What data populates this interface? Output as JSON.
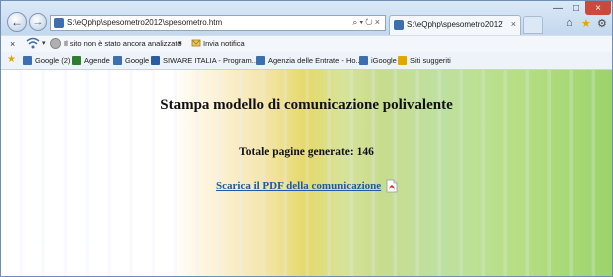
{
  "browser": {
    "address_url": "S:\\eQphp\\spesometro2012\\spesometro.htm",
    "tab_title": "S:\\eQphp\\spesometro2012\\...",
    "window_controls": [
      "minimize",
      "maximize",
      "close"
    ]
  },
  "toolbar": {
    "safety_status": "Il sito non è stato ancora analizzato",
    "send_report": "Invia notifica"
  },
  "favorites": [
    {
      "label": "Google (2)",
      "icon": "google-icon",
      "color": "#3c6eb0"
    },
    {
      "label": "Agende",
      "icon": "agenda-icon",
      "color": "#2f7d2f"
    },
    {
      "label": "Google",
      "icon": "google-icon",
      "color": "#3c6eb0"
    },
    {
      "label": "SIWARE ITALIA - Program...",
      "icon": "siware-icon",
      "color": "#2b5aa0"
    },
    {
      "label": "Agenzia delle Entrate - Ho...",
      "icon": "agenzia-icon",
      "color": "#3a6fb0"
    },
    {
      "label": "iGoogle",
      "icon": "google-icon",
      "color": "#3c6eb0"
    },
    {
      "label": "Siti suggeriti",
      "icon": "suggested-sites-icon",
      "color": "#e0a800"
    }
  ],
  "page": {
    "title": "Stampa modello di comunicazione polivalente",
    "pages_generated": "Totale pagine generate: 146",
    "download_link": "Scarica il PDF della comunicazione"
  },
  "colors": {
    "link": "#2157a6",
    "chrome_frame": "#6e8fb3",
    "close_button": "#c94a3a"
  }
}
